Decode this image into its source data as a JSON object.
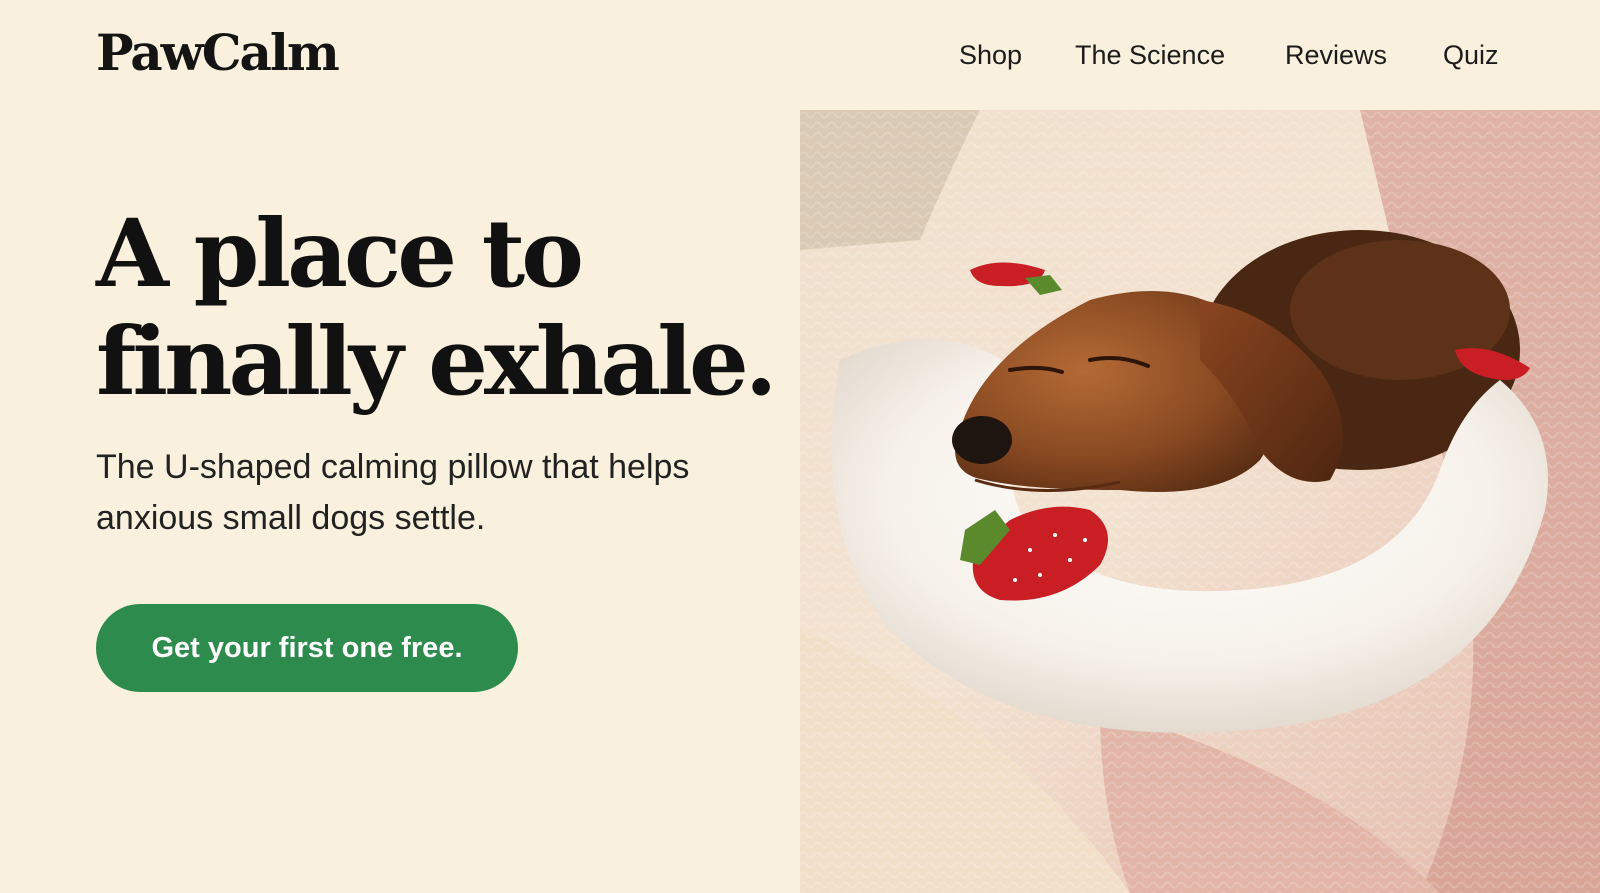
{
  "brand": {
    "name": "PawCalm"
  },
  "nav": {
    "items": [
      {
        "label": "Shop"
      },
      {
        "label": "The Science"
      },
      {
        "label": "Reviews"
      },
      {
        "label": "Quiz"
      }
    ]
  },
  "hero": {
    "headline_line1": "A place to",
    "headline_line2": "finally exhale.",
    "subheadline": "The U-shaped calming pillow that helps anxious small dogs settle.",
    "cta_label": "Get your first one free."
  },
  "photo": {
    "subject": "dachshund-on-u-shaped-pillow"
  },
  "colors": {
    "background": "#faf0de",
    "cta_green": "#2e8b4e",
    "text": "#141414"
  }
}
